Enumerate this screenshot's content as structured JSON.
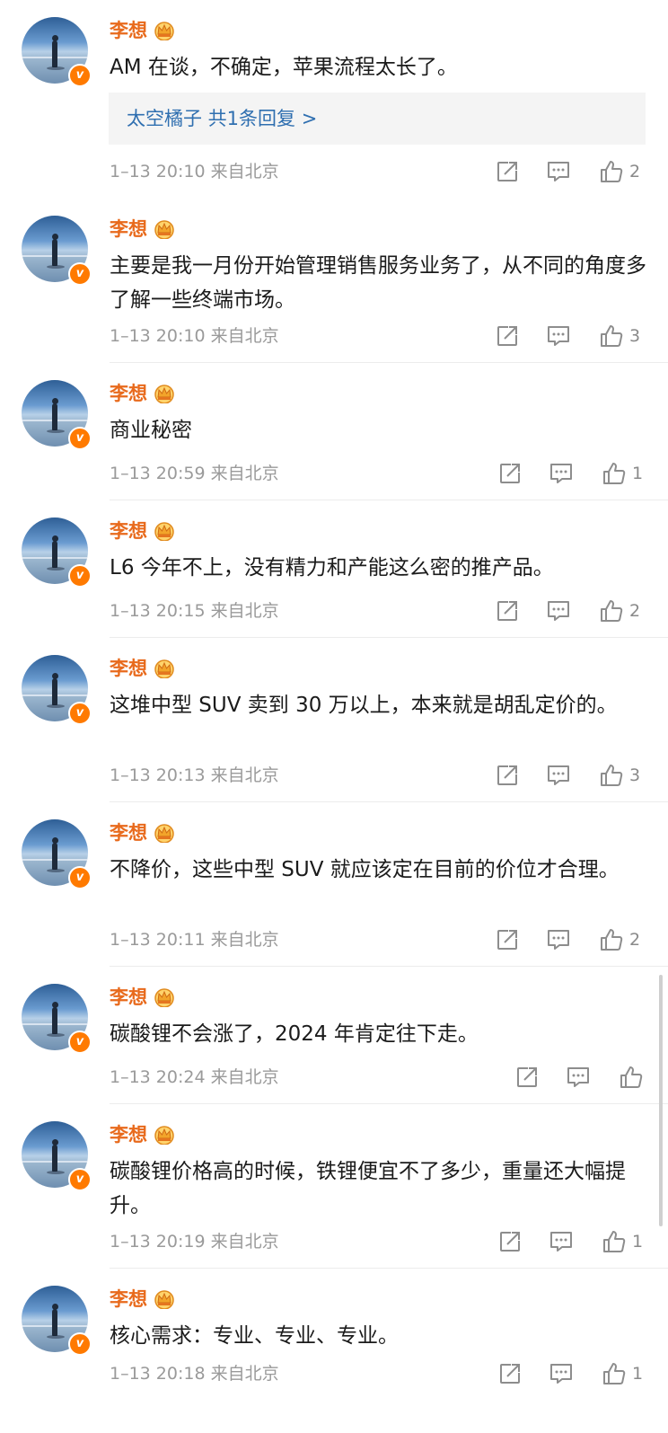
{
  "comments": [
    {
      "author": "李想",
      "text": "AM 在谈，不确定，苹果流程太长了。",
      "reply_link": "太空橘子 共1条回复 >",
      "time": "1–13 20:10",
      "location": "来自北京",
      "likes": "2"
    },
    {
      "author": "李想",
      "text": "主要是我一月份开始管理销售服务业务了，从不同的角度多了解一些终端市场。",
      "time": "1–13 20:10",
      "location": "来自北京",
      "likes": "3"
    },
    {
      "author": "李想",
      "text": "商业秘密",
      "time": "1–13 20:59",
      "location": "来自北京",
      "likes": "1"
    },
    {
      "author": "李想",
      "text": "L6 今年不上，没有精力和产能这么密的推产品。",
      "time": "1–13 20:15",
      "location": "来自北京",
      "likes": "2"
    },
    {
      "author": "李想",
      "text": "这堆中型 SUV 卖到 30 万以上，本来就是胡乱定价的。",
      "time": "1–13 20:13",
      "location": "来自北京",
      "likes": "3"
    },
    {
      "author": "李想",
      "text": "不降价，这些中型 SUV 就应该定在目前的价位才合理。",
      "time": "1–13 20:11",
      "location": "来自北京",
      "likes": "2"
    },
    {
      "author": "李想",
      "text": "碳酸锂不会涨了，2024 年肯定往下走。",
      "time": "1–13 20:24",
      "location": "来自北京",
      "likes": ""
    },
    {
      "author": "李想",
      "text": "碳酸锂价格高的时候，铁锂便宜不了多少，重量还大幅提升。",
      "time": "1–13 20:19",
      "location": "来自北京",
      "likes": "1"
    },
    {
      "author": "李想",
      "text": "核心需求：专业、专业、专业。",
      "time": "1–13 20:18",
      "location": "来自北京",
      "likes": "1"
    }
  ],
  "colors": {
    "author": "#e86a1c",
    "reply_link": "#2f6fb0",
    "meta": "#9a9a9a",
    "verified_badge": "#ff7a00"
  },
  "icons": {
    "share": "share-icon",
    "comment": "comment-icon",
    "like": "thumbs-up-icon",
    "crown": "crown-icon",
    "verified": "verified-badge-icon"
  }
}
